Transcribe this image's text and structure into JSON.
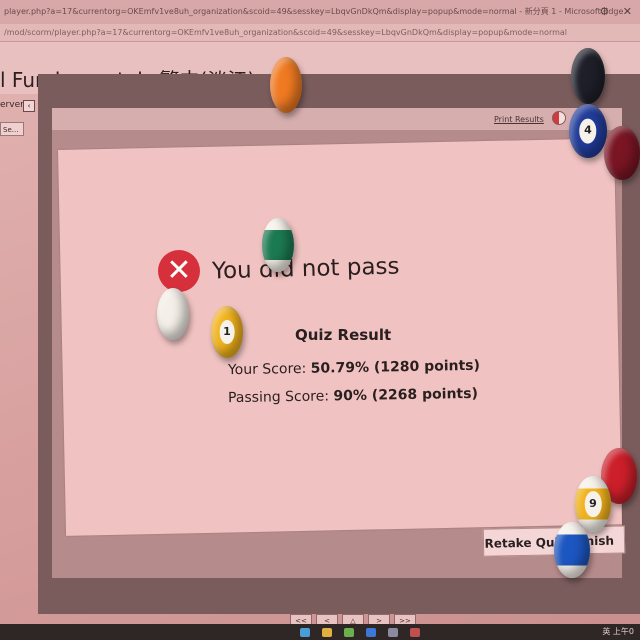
{
  "browser": {
    "title_text": "player.php?a=17&currentorg=OKEmfv1ve8uh_organization&scoid=49&sesskey=LbqvGnDkQm&display=popup&mode=normal - 新分頁 1 - Microsoft Edge",
    "address_text": "/mod/scorm/player.php?a=17&currentorg=OKEmfv1ve8uh_organization&scoid=49&sesskey=LbqvGnDkQm&display=popup&mode=normal",
    "controls": [
      "⚙",
      "✕"
    ]
  },
  "course": {
    "title": "l Fundamentals 繁中(淡江)"
  },
  "sidebar": {
    "label": "erver",
    "toggle": "‹",
    "button": "Se..."
  },
  "toolbar": {
    "print_results": "Print Results"
  },
  "result": {
    "heading": "You did not pass",
    "fail_icon": "✕",
    "quiz_result_label": "Quiz Result",
    "your_score_label": "Your Score: ",
    "your_score_value": "50.79% (1280 points)",
    "passing_score_label": "Passing Score: ",
    "passing_score_value": "90% (2268 points)"
  },
  "actions": {
    "retake": "Retake Quiz",
    "finish": "Finish"
  },
  "pager": [
    "<<",
    "<",
    "△",
    ">",
    ">>"
  ],
  "taskbar": {
    "tray_text": "英 上午0"
  },
  "overlay_balls": [
    {
      "number": "",
      "color": "#f07a22",
      "kind": "solid-plain"
    },
    {
      "number": "",
      "color": "#1f1f2a",
      "kind": "solid-plain"
    },
    {
      "number": "4",
      "color": "#213c9a",
      "kind": "solid"
    },
    {
      "number": "",
      "color": "#7a1524",
      "kind": "solid-plain"
    },
    {
      "number": "",
      "color": "#1c7a52",
      "kind": "stripe"
    },
    {
      "number": "",
      "color": "#f4efe8",
      "kind": "cue"
    },
    {
      "number": "1",
      "color": "#f2b31c",
      "kind": "solid"
    },
    {
      "number": "",
      "color": "#cc1f2a",
      "kind": "solid-plain"
    },
    {
      "number": "9",
      "color": "#f2b31c",
      "kind": "stripe"
    },
    {
      "number": "",
      "color": "#1c56c0",
      "kind": "stripe"
    }
  ]
}
